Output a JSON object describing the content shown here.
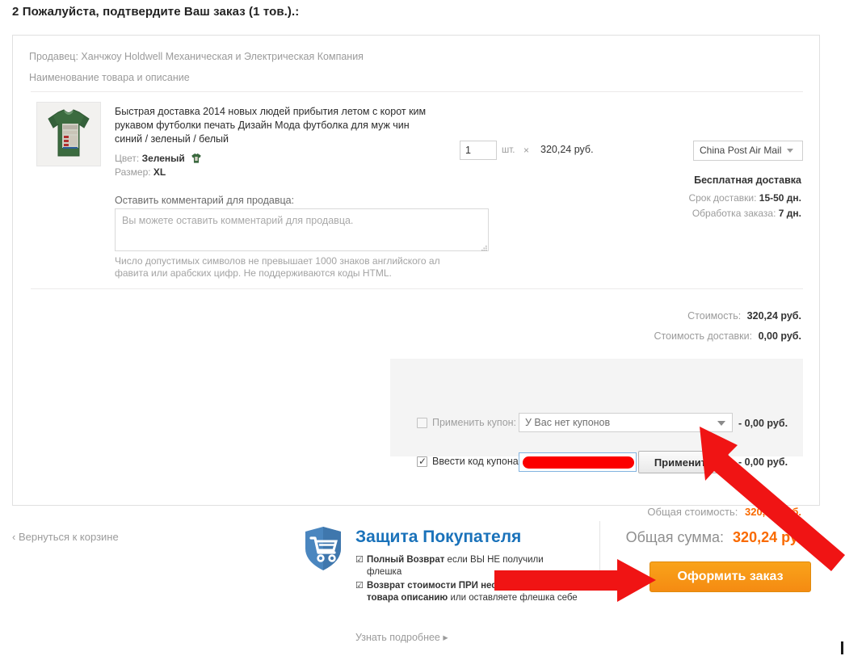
{
  "page": {
    "title": "2 Пожалуйста, подтвердите Ваш заказ (1 тов.).:"
  },
  "order_card": {
    "seller_line": "Продавец: Ханчжоу Holdwell Механическая и Электрическая Компания",
    "goods_header": "Наименование товара и описание",
    "product": {
      "title": "Быстрая доставка 2014 новых людей прибытия летом с корот ким рукавом футболки печать Дизайн Мода футболка для муж чин синий / зеленый / белый",
      "color_key": "Цвет:",
      "color_value": "Зеленый",
      "size_key": "Размер:",
      "size_value": "XL",
      "thumb_icon": "tshirt-green-thumbnail"
    },
    "comment": {
      "label": "Оставить комментарий для продавца:",
      "value": "",
      "placeholder": "Вы можете оставить комментарий для продавца.",
      "hint": "Число допустимых символов не превышает 1000 знаков английского ал фавита или арабских цифр. Не поддерживаются коды HTML."
    },
    "quantity": {
      "value": "1",
      "unit": "шт.",
      "times": "×",
      "unit_price": "320,24 руб."
    },
    "shipping": {
      "method": "China Post Air Mail",
      "free_label": "Бесплатная доставка",
      "delivery_key": "Срок доставки:",
      "delivery_value": "15-50 дн.",
      "processing_key": "Обработка заказа:",
      "processing_value": "7 дн."
    },
    "costs": [
      {
        "key": "Стоимость:",
        "value": "320,24 руб."
      },
      {
        "key": "Стоимость доставки:",
        "value": "0,00 руб."
      }
    ],
    "coupon": {
      "apply_coupon_label": "Применить купон:",
      "select_value": "У Вас нет купонов",
      "select_discount": "- 0,00 руб.",
      "enter_code_label": "Ввести код купона:",
      "code_value": "",
      "apply_button": "Применить",
      "code_discount": "- 0,00 руб."
    },
    "grand": {
      "key": "Общая стоимость:",
      "value": "320,24 руб."
    }
  },
  "footer": {
    "back_link": "‹ Вернуться к корзине",
    "buyer_protection": {
      "icon": "shield-cart-icon",
      "title": "Защита Покупателя",
      "items": [
        {
          "check": "☑",
          "strong": "Полный Возврат",
          "rest": " если ВЫ НЕ получили флешка"
        },
        {
          "check": "☑",
          "strong": "Возврат стоимости ПРИ несоответствии товара описанию",
          "rest": " или оставляете флешка себе"
        }
      ],
      "more_link": "Узнать подробнее ▸"
    },
    "total": {
      "key": "Общая сумма:",
      "value": "320,24 руб."
    },
    "order_button": "Оформить заказ"
  },
  "colors": {
    "accent_orange": "#f96a00",
    "button_orange": "#f9a31a",
    "brand_blue": "#1a72ba",
    "arrow_red": "#f01414",
    "redaction_red": "#fb0000"
  },
  "annotations": [
    {
      "name": "arrow-to-apply-button",
      "shape": "arrow",
      "color": "#f01414"
    },
    {
      "name": "arrow-to-order-button",
      "shape": "arrow",
      "color": "#f01414"
    }
  ]
}
